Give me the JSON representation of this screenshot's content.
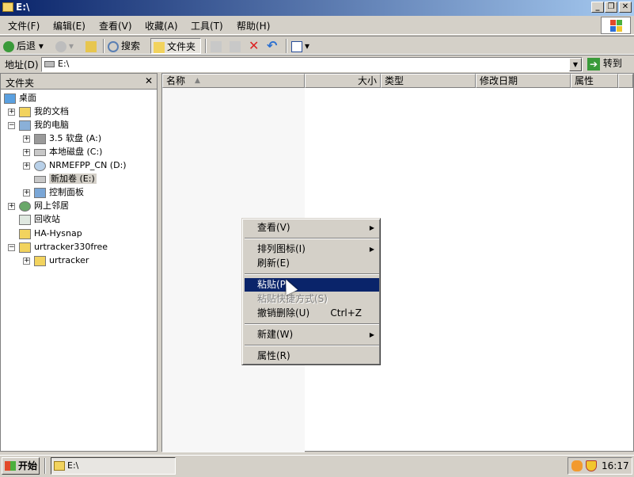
{
  "window": {
    "title": "E:\\"
  },
  "menubar": [
    {
      "label": "文件(F)"
    },
    {
      "label": "编辑(E)"
    },
    {
      "label": "查看(V)"
    },
    {
      "label": "收藏(A)"
    },
    {
      "label": "工具(T)"
    },
    {
      "label": "帮助(H)"
    }
  ],
  "toolbar": {
    "back_label": "后退",
    "search_label": "搜索",
    "folders_label": "文件夹"
  },
  "address": {
    "label": "地址(D)",
    "value": "E:\\",
    "go_label": "转到"
  },
  "folder_pane": {
    "title": "文件夹",
    "close_glyph": "✕",
    "items": [
      {
        "label": "桌面",
        "icon": "desktop-icon"
      },
      {
        "label": "我的文档",
        "icon": "documents-icon",
        "expander": "+"
      },
      {
        "label": "我的电脑",
        "icon": "computer-icon",
        "expander": "−"
      },
      {
        "label": "3.5 软盘 (A:)",
        "icon": "floppy-icon",
        "expander": "+"
      },
      {
        "label": "本地磁盘 (C:)",
        "icon": "drive-icon",
        "expander": "+"
      },
      {
        "label": "NRMEFPP_CN (D:)",
        "icon": "cd-icon",
        "expander": "+"
      },
      {
        "label": "新加卷 (E:)",
        "icon": "drive-icon"
      },
      {
        "label": "控制面板",
        "icon": "control-panel-icon",
        "expander": "+"
      },
      {
        "label": "网上邻居",
        "icon": "network-icon",
        "expander": "+"
      },
      {
        "label": "回收站",
        "icon": "recycle-bin-icon"
      },
      {
        "label": "HA-Hysnap",
        "icon": "folder-icon"
      },
      {
        "label": "urtracker330free",
        "icon": "folder-icon",
        "expander": "−"
      },
      {
        "label": "urtracker",
        "icon": "folder-icon",
        "expander": "+"
      }
    ]
  },
  "file_pane": {
    "columns": [
      "名称",
      "大小",
      "类型",
      "修改日期",
      "属性"
    ]
  },
  "context_menu": {
    "items": [
      {
        "label": "查看(V)",
        "submenu": true
      },
      {
        "label": "排列图标(I)",
        "submenu": true
      },
      {
        "label": "刷新(E)"
      },
      {
        "label": "粘贴(P)",
        "selected": true
      },
      {
        "label": "粘贴快捷方式(S)",
        "disabled": true
      },
      {
        "label": "撤销删除(U)",
        "shortcut": "Ctrl+Z"
      },
      {
        "label": "新建(W)",
        "submenu": true
      },
      {
        "label": "属性(R)"
      }
    ]
  },
  "taskbar": {
    "start_label": "开始",
    "task_label": "E:\\",
    "clock": "16:17"
  },
  "colors": {
    "title_active": "#0a246a",
    "selection": "#0a246a",
    "face": "#d4d0c8"
  }
}
